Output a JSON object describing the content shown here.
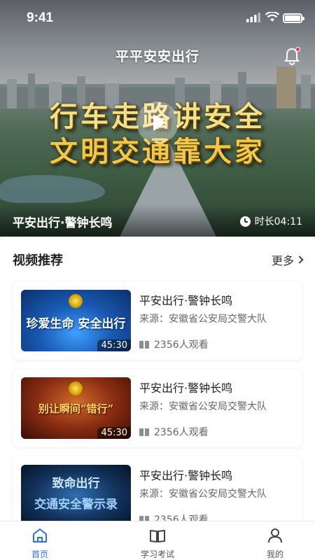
{
  "status_bar": {
    "time": "9:41"
  },
  "header": {
    "title": "平平安安出行"
  },
  "hero": {
    "slogan_line1": "行车走路讲安全",
    "slogan_line2": "文明交通靠大家",
    "caption": "平安出行·警钟长鸣",
    "duration": "时长04:11"
  },
  "section": {
    "title": "视频推荐",
    "more_label": "更多"
  },
  "videos": [
    {
      "thumb_text": "珍爱生命 安全出行",
      "duration": "45:30",
      "title": "平安出行·警钟长鸣",
      "source": "来源：安徽省公安局交警大队",
      "views": "2356人观看"
    },
    {
      "thumb_text": "别让瞬间“错行”",
      "duration": "45:30",
      "title": "平安出行·警钟长鸣",
      "source": "来源：安徽省公安局交警大队",
      "views": "2356人观看"
    },
    {
      "thumb_text_line1": "致命出行",
      "thumb_text_line2": "交通安全警示录",
      "title": "平安出行·警钟长鸣",
      "source": "来源：安徽省公安局交警大队",
      "views": "2356人观看"
    }
  ],
  "tabbar": {
    "home": "首页",
    "study": "学习考试",
    "mine": "我的"
  },
  "colors": {
    "accent": "#2a6df5",
    "notification_dot": "#e53935",
    "slogan_gold": "#f0c94c"
  },
  "icons": [
    "bell-icon",
    "play-icon",
    "clock-icon",
    "chevron-right-icon",
    "book-icon",
    "home-icon",
    "open-book-icon",
    "person-icon"
  ]
}
